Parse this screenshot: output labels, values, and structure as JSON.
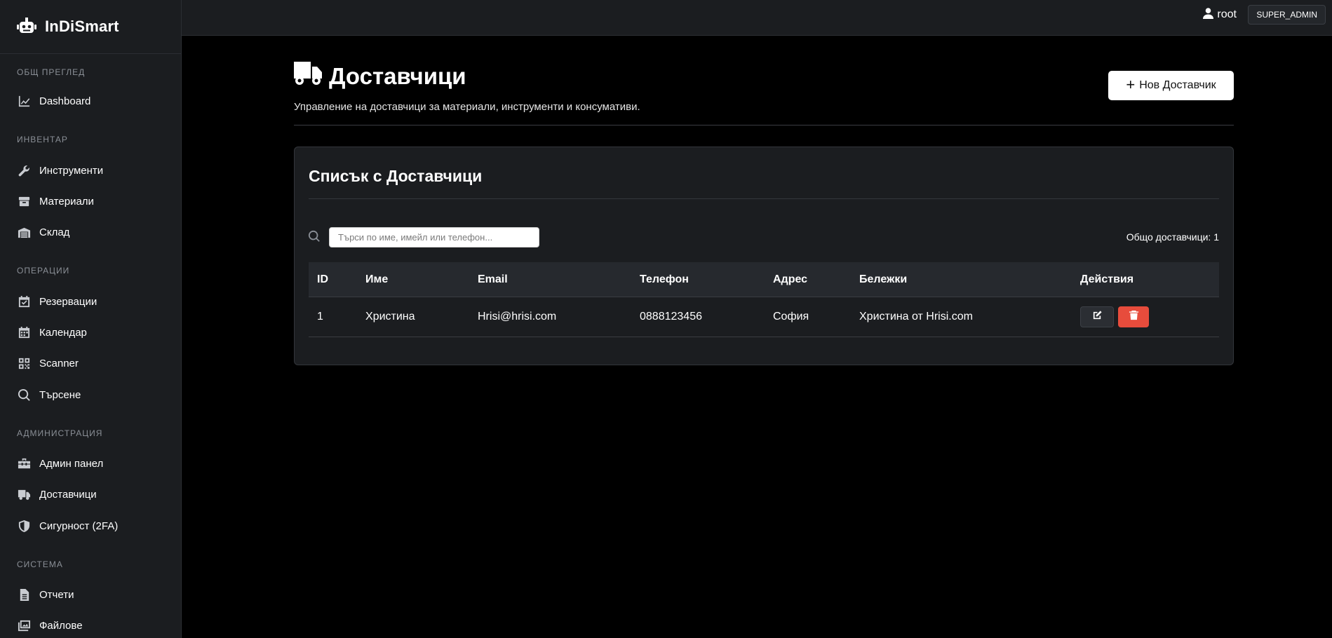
{
  "brand": {
    "name": "InDiSmart"
  },
  "sidebar": {
    "sections": [
      {
        "label": "ОБЩ ПРЕГЛЕД",
        "items": [
          {
            "label": "Dashboard",
            "icon": "chart-line-icon"
          }
        ]
      },
      {
        "label": "ИНВЕНТАР",
        "items": [
          {
            "label": "Инструменти",
            "icon": "wrench-icon"
          },
          {
            "label": "Материали",
            "icon": "box-icon"
          },
          {
            "label": "Склад",
            "icon": "warehouse-icon"
          }
        ]
      },
      {
        "label": "ОПЕРАЦИИ",
        "items": [
          {
            "label": "Резервации",
            "icon": "calendar-check-icon"
          },
          {
            "label": "Календар",
            "icon": "calendar-icon"
          },
          {
            "label": "Scanner",
            "icon": "qrcode-icon"
          },
          {
            "label": "Търсене",
            "icon": "search-icon"
          }
        ]
      },
      {
        "label": "АДМИНИСТРАЦИЯ",
        "items": [
          {
            "label": "Админ панел",
            "icon": "toolbox-icon"
          },
          {
            "label": "Доставчици",
            "icon": "truck-icon"
          },
          {
            "label": "Сигурност (2FA)",
            "icon": "shield-icon"
          }
        ]
      },
      {
        "label": "СИСТЕМА",
        "items": [
          {
            "label": "Отчети",
            "icon": "file-icon"
          },
          {
            "label": "Файлове",
            "icon": "images-icon"
          }
        ]
      }
    ]
  },
  "topbar": {
    "username": "root",
    "role": "SUPER_ADMIN"
  },
  "page": {
    "title": "Доставчици",
    "subtitle": "Управление на доставчици за материали, инструменти и консумативи.",
    "new_button": "Нов Доставчик"
  },
  "card": {
    "title": "Списък с Доставчици",
    "search_placeholder": "Търси по име, имейл или телефон...",
    "search_value": "",
    "total_label": "Общо доставчици: 1"
  },
  "table": {
    "headers": [
      "ID",
      "Име",
      "Email",
      "Телефон",
      "Адрес",
      "Бележки",
      "Действия"
    ],
    "rows": [
      {
        "id": "1",
        "name": "Христина",
        "email": "Hrisi@hrisi.com",
        "phone": "0888123456",
        "address": "София",
        "notes": "Христина от Hrisi.com"
      }
    ]
  },
  "colors": {
    "background": "#000000",
    "sidebar": "#1b1d20",
    "danger": "#e74c3c",
    "primary_button": "#ffffff"
  }
}
